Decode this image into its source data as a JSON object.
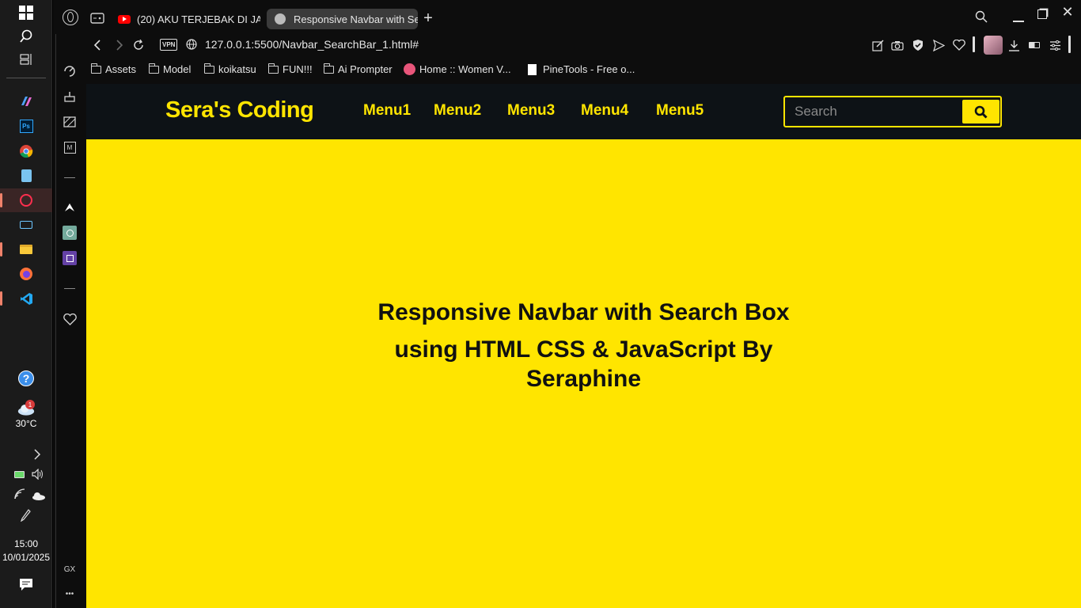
{
  "taskbar": {
    "weather_temp": "30°C",
    "weather_badge": "1",
    "time": "15:00",
    "date": "10/01/2025"
  },
  "gx_sidebar": {
    "gx_label": "GX",
    "more_label": "•••"
  },
  "tabs": [
    {
      "title": "(20) AKU TERJEBAK DI JA",
      "icon": "youtube-icon"
    },
    {
      "title": "Responsive Navbar with Se",
      "icon": "globe-icon"
    }
  ],
  "address": {
    "vpn_label": "VPN",
    "url": "127.0.0.1:5500/Navbar_SearchBar_1.html#"
  },
  "bookmarks": [
    {
      "label": "Assets"
    },
    {
      "label": "Model"
    },
    {
      "label": "koikatsu"
    },
    {
      "label": "FUN!!!"
    },
    {
      "label": "Ai Prompter"
    },
    {
      "label": "Home :: Women V..."
    },
    {
      "label": "PineTools - Free o..."
    }
  ],
  "site": {
    "brand": "Sera's Coding",
    "menu": [
      "Menu1",
      "Menu2",
      "Menu3",
      "Menu4",
      "Menu5"
    ],
    "search_placeholder": "Search",
    "hero_line1": "Responsive Navbar with Search Box",
    "hero_line2": "using HTML CSS & JavaScript By",
    "hero_line3": "Seraphine"
  },
  "colors": {
    "accent_yellow": "#ffe500",
    "navbar_bg": "#0d1216",
    "browser_bg": "#0d0d0d"
  }
}
